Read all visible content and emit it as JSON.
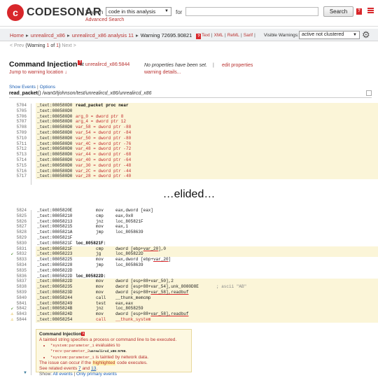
{
  "header": {
    "logo_letter": "c",
    "logo_text": "CODESONAR",
    "search_label": "Search",
    "search_scope": "code in this analysis",
    "for_label": "for",
    "search_placeholder": "",
    "search_button": "Search",
    "help_glyph": "?",
    "advanced_search": "Advanced Search"
  },
  "breadcrumb": {
    "items": [
      "Home",
      "unrealircd_x86",
      "unrealircd_x86 analysis 11"
    ],
    "current": "Warning 72695.90821",
    "help_glyph": "?",
    "formats": [
      "Text",
      "XML",
      "ReML",
      "Sarif"
    ],
    "visible_warnings_label": "Visible Warnings:",
    "visible_warnings_value": "active not clustered"
  },
  "nav": {
    "prev": "< Prev",
    "open": "(Warning ",
    "index": "1",
    "of": " of ",
    "total": "1",
    "close": ")",
    "next": "Next >"
  },
  "warning": {
    "title": "Command Injection",
    "help_glyph": "?",
    "at_label": "at",
    "location": "unrealircd_x86:5844",
    "jump_link": "Jump to warning location ↓",
    "no_properties": "No properties have been set.",
    "divider": "|",
    "edit_properties": "edit properties",
    "warning_details": "warning details..."
  },
  "events": {
    "show_events": "Show Events",
    "divider": "|",
    "options": "Options",
    "function_name": "read_packet",
    "function_suffix": "()",
    "path": " /wan0/tjohnson/test/unrealircd_x86/unrealircd_x86"
  },
  "code_top": [
    {
      "ln": "5704",
      "addr": "_text:080580D0",
      "lbl": "read_packet proc near",
      "mn": "",
      "op": "",
      "hl": true
    },
    {
      "ln": "5705",
      "addr": "_text:080580D0",
      "lbl": "",
      "mn": "",
      "op": "",
      "hl": true
    },
    {
      "ln": "5706",
      "addr": "_text:080580D0",
      "lbl": "",
      "mn": "arg_0 = dword ptr  8",
      "op": "",
      "hl": true
    },
    {
      "ln": "5707",
      "addr": "_text:080580D0",
      "lbl": "",
      "mn": "arg_4 = dword ptr  12",
      "op": "",
      "hl": true
    },
    {
      "ln": "5708",
      "addr": "_text:080580D0",
      "lbl": "",
      "mn": "var_58 = dword ptr -88",
      "op": "",
      "hl": true
    },
    {
      "ln": "5709",
      "addr": "_text:080580D0",
      "lbl": "",
      "mn": "var_54 = dword ptr -84",
      "op": "",
      "hl": true
    },
    {
      "ln": "5710",
      "addr": "_text:080580D0",
      "lbl": "",
      "mn": "var_50 = dword ptr -80",
      "op": "",
      "hl": true
    },
    {
      "ln": "5711",
      "addr": "_text:080580D0",
      "lbl": "",
      "mn": "var_4C = dword ptr -76",
      "op": "",
      "hl": true
    },
    {
      "ln": "5712",
      "addr": "_text:080580D0",
      "lbl": "",
      "mn": "var_48 = dword ptr -72",
      "op": "",
      "hl": true
    },
    {
      "ln": "5713",
      "addr": "_text:080580D0",
      "lbl": "",
      "mn": "var_44 = dword ptr -68",
      "op": "",
      "hl": true
    },
    {
      "ln": "5714",
      "addr": "_text:080580D0",
      "lbl": "",
      "mn": "var_40 = dword ptr -64",
      "op": "",
      "hl": true
    },
    {
      "ln": "5715",
      "addr": "_text:080580D0",
      "lbl": "",
      "mn": "var_30 = dword ptr -48",
      "op": "",
      "hl": true
    },
    {
      "ln": "5716",
      "addr": "_text:080580D0",
      "lbl": "",
      "mn": "var_2C = dword ptr -44",
      "op": "",
      "hl": true
    },
    {
      "ln": "5717",
      "addr": "_text:080580D0",
      "lbl": "",
      "mn": "var_28 = dword ptr -40",
      "op": "",
      "hl": true
    }
  ],
  "elided": "…elided…",
  "code_bottom": [
    {
      "ln": "5824",
      "addr": "_text:0805820E",
      "lbl": "",
      "mn": "mov",
      "op": "eax,dword [eax]",
      "hl": false,
      "mark": ""
    },
    {
      "ln": "5825",
      "addr": "_text:08058210",
      "lbl": "",
      "mn": "cmp",
      "op": "eax,0x8",
      "hl": false,
      "mark": ""
    },
    {
      "ln": "5826",
      "addr": "_text:08058213",
      "lbl": "",
      "mn": "jnz",
      "op": "loc_805821F",
      "hl": false,
      "mark": ""
    },
    {
      "ln": "5827",
      "addr": "_text:08058215",
      "lbl": "",
      "mn": "mov",
      "op": "eax,1",
      "hl": false,
      "mark": ""
    },
    {
      "ln": "5828",
      "addr": "_text:0805821A",
      "lbl": "",
      "mn": "jmp",
      "op": "loc_8058639",
      "hl": false,
      "mark": ""
    },
    {
      "ln": "5829",
      "addr": "_text:0805821F",
      "lbl": "",
      "mn": "",
      "op": "",
      "hl": false,
      "mark": ""
    },
    {
      "ln": "5830",
      "addr": "_text:0805821F",
      "lbl": "loc_805821F:",
      "mn": "",
      "op": "",
      "hl": false,
      "mark": ""
    },
    {
      "ln": "5831",
      "addr": "_text:0805821F",
      "lbl": "",
      "mn": "cmp",
      "op": "dword [ebp+var_20],0",
      "hl": true,
      "mark": "",
      "ulop": "var_20"
    },
    {
      "ln": "5832",
      "addr": "_text:08058223",
      "lbl": "",
      "mn": "jg",
      "op": "loc_805822D",
      "hl": true,
      "mark": "ok"
    },
    {
      "ln": "5833",
      "addr": "_text:08058225",
      "lbl": "",
      "mn": "mov",
      "op": "eax,dword [ebp+var_20]",
      "hl": false,
      "mark": "",
      "ulop": "var_20"
    },
    {
      "ln": "5834",
      "addr": "_text:08058228",
      "lbl": "",
      "mn": "jmp",
      "op": "loc_8058639",
      "hl": false,
      "mark": ""
    },
    {
      "ln": "5835",
      "addr": "_text:0805822D",
      "lbl": "",
      "mn": "",
      "op": "",
      "hl": false,
      "mark": ""
    },
    {
      "ln": "5836",
      "addr": "_text:0805822D",
      "lbl": "loc_805822D:",
      "mn": "",
      "op": "",
      "hl": false,
      "mark": ""
    },
    {
      "ln": "5837",
      "addr": "_text:0805822D",
      "lbl": "",
      "mn": "mov",
      "op": "dword [esp+88+var_50],2",
      "hl": true,
      "mark": ""
    },
    {
      "ln": "5838",
      "addr": "_text:08058235",
      "lbl": "",
      "mn": "mov",
      "op": "dword [esp+88+var_54],unk_8080D8E",
      "hl": true,
      "mark": "",
      "cm": "; ascii \"AB\""
    },
    {
      "ln": "5839",
      "addr": "_text:0805823D",
      "lbl": "",
      "mn": "mov",
      "op": "dword [esp+88+var_58],readbuf",
      "hl": true,
      "mark": "",
      "ulop": "var_58],readbuf"
    },
    {
      "ln": "5840",
      "addr": "_text:08058244",
      "lbl": "",
      "mn": "call",
      "op": "__thunk_memcmp",
      "hl": true,
      "mark": ""
    },
    {
      "ln": "5841",
      "addr": "_text:08058249",
      "lbl": "",
      "mn": "test",
      "op": "eax,eax",
      "hl": true,
      "mark": ""
    },
    {
      "ln": "5842",
      "addr": "_text:0805824B",
      "lbl": "",
      "mn": "jnz",
      "op": "loc_8058259",
      "hl": true,
      "mark": "ok"
    },
    {
      "ln": "5843",
      "addr": "_text:0805824D",
      "lbl": "",
      "mn": "mov",
      "op": "dword [esp+88+var_58],readbuf",
      "hl": true,
      "mark": "warn",
      "ulop": "var_58],readbuf"
    },
    {
      "ln": "5844",
      "addr": "_text:08058254",
      "lbl": "",
      "mn": "call",
      "op": "__thunk_system",
      "hl": true,
      "mark": "warn",
      "red": true
    }
  ],
  "callout": {
    "title": "Command Injection",
    "help_glyph": "?",
    "desc": "A tainted string specifies a process or command line to be executed.",
    "bullets": [
      {
        "pre": "*system:parameter_1",
        "mid": " evaluates to ",
        "code": "*recv:parameter_2",
        "loc": "unrealircd_x86:5796",
        "post": "."
      },
      {
        "pre": "*system:parameter_1",
        "mid": " is tainted by network data.",
        "code": "",
        "loc": "",
        "post": ""
      }
    ],
    "issue_pre": "The issue can occur if the ",
    "issue_hl": "highlighted",
    "issue_post": " code executes.",
    "related_pre": "See related events ",
    "related_a": "7",
    "related_and": " and ",
    "related_b": "13",
    "related_end": ".",
    "show_label": "Show:",
    "show_all": "All events",
    "show_sep": "|",
    "show_primary": "Only primary events"
  },
  "colors": {
    "brand": "#d8272b",
    "link": "#b8312f",
    "highlight": "#fbf5d8"
  }
}
